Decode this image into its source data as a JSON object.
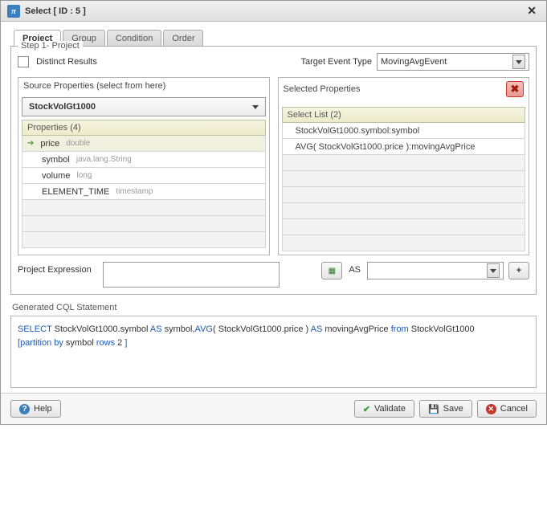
{
  "title": "Select [ ID : 5 ]",
  "tabs": [
    "Project",
    "Group",
    "Condition",
    "Order"
  ],
  "active_tab": 0,
  "step_label": "Step 1- Project",
  "distinct": {
    "label": "Distinct Results",
    "checked": false
  },
  "target_event": {
    "label": "Target Event Type",
    "value": "MovingAvgEvent"
  },
  "source_panel": {
    "title": "Source Properties (select from here)",
    "source": "StockVolGt1000",
    "prop_header": "Properties (4)",
    "rows": [
      {
        "name": "price",
        "type": "double",
        "active": true
      },
      {
        "name": "symbol",
        "type": "java.lang.String",
        "active": false
      },
      {
        "name": "volume",
        "type": "long",
        "active": false
      },
      {
        "name": "ELEMENT_TIME",
        "type": "timestamp",
        "active": false
      }
    ]
  },
  "selected_panel": {
    "title": "Selected Properties",
    "list_header": "Select List (2)",
    "items": [
      "StockVolGt1000.symbol:symbol",
      "AVG( StockVolGt1000.price ):movingAvgPrice"
    ]
  },
  "expression": {
    "label": "Project Expression",
    "value": "",
    "as_label": "AS",
    "as_value": ""
  },
  "cql": {
    "label": "Generated CQL Statement",
    "segments": [
      {
        "t": "SELECT",
        "k": true
      },
      {
        "t": " StockVolGt1000.symbol "
      },
      {
        "t": "AS",
        "k": true
      },
      {
        "t": " symbol,"
      },
      {
        "t": "AVG",
        "k": true
      },
      {
        "t": "( StockVolGt1000.price ) "
      },
      {
        "t": "AS",
        "k": true
      },
      {
        "t": " movingAvgPrice "
      },
      {
        "t": "from",
        "k": true
      },
      {
        "t": "  StockVolGt1000 "
      },
      {
        "br": true
      },
      {
        "t": "[",
        "k": true
      },
      {
        "t": "partition by",
        "k": true
      },
      {
        "t": "  symbol  "
      },
      {
        "t": "rows",
        "k": true
      },
      {
        "t": " 2 "
      },
      {
        "t": "]",
        "k": true
      }
    ]
  },
  "footer": {
    "help": "Help",
    "validate": "Validate",
    "save": "Save",
    "cancel": "Cancel"
  }
}
